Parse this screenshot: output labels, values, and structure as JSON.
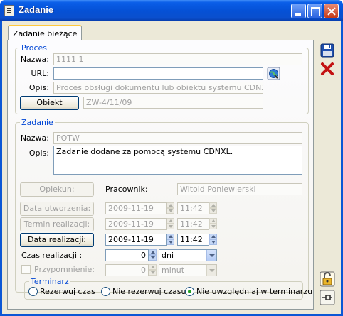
{
  "window": {
    "title": "Zadanie"
  },
  "tab": {
    "label": "Zadanie bieżące"
  },
  "proces": {
    "legend": "Proces",
    "nazwa_label": "Nazwa:",
    "nazwa_value": "1111 1",
    "url_label": "URL:",
    "url_value": "",
    "opis_label": "Opis:",
    "opis_value": "Proces obsługi dokumentu lub obiektu systemu CDNXL",
    "obiekt_button": "Obiekt",
    "obiekt_value": "ZW-4/11/09"
  },
  "zadanie": {
    "legend": "Zadanie",
    "nazwa_label": "Nazwa:",
    "nazwa_value": "POTW",
    "opis_label": "Opis:",
    "opis_value": "Zadanie dodane za pomocą systemu CDNXL.",
    "opiekun_button": "Opiekun:",
    "pracownik_label": "Pracownik:",
    "pracownik_value": "Witold Poniewierski",
    "data_utworzenia_button": "Data utworzenia:",
    "data_utworzenia_date": "2009-11-19",
    "data_utworzenia_time": "11:42",
    "termin_realizacji_button": "Termin realizacji:",
    "termin_realizacji_date": "2009-11-19",
    "termin_realizacji_time": "11:42",
    "data_realizacji_button": "Data realizacji:",
    "data_realizacji_date": "2009-11-19",
    "data_realizacji_time": "11:42",
    "czas_realizacji_label": "Czas realizacji :",
    "czas_realizacji_value": "0",
    "czas_realizacji_unit": "dni",
    "przypomnienie_label": "Przypomnienie:",
    "przypomnienie_value": "0",
    "przypomnienie_unit": "minut"
  },
  "terminarz": {
    "legend": "Terminarz",
    "options": [
      {
        "label": "Rezerwuj czas",
        "selected": false
      },
      {
        "label": "Nie rezerwuj czasu",
        "selected": false
      },
      {
        "label": "Nie uwzględniaj w terminarzu",
        "selected": true
      }
    ]
  },
  "side_icons": [
    "save-icon",
    "cancel-icon",
    "unlock-icon",
    "pin-icon"
  ]
}
